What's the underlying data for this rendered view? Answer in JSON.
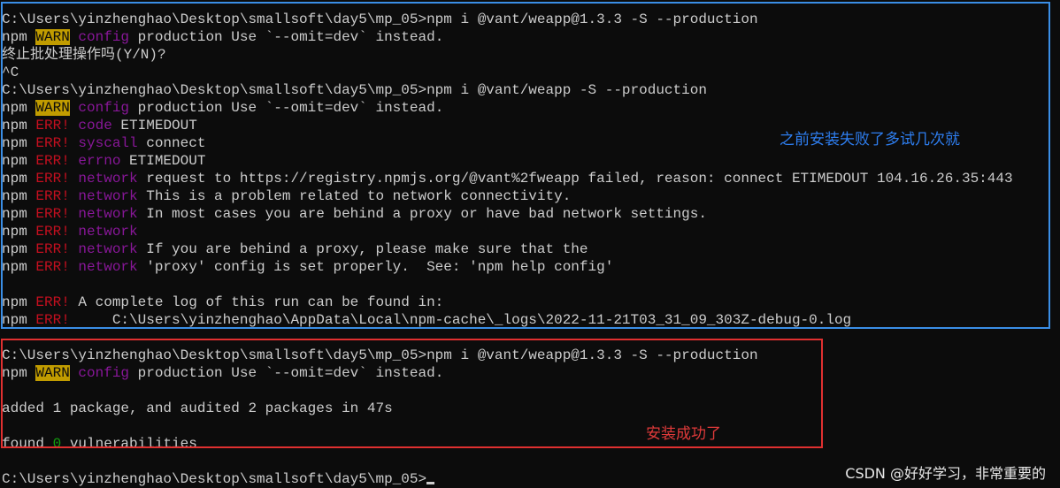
{
  "terminal": {
    "lines": [
      {
        "text": "C:\\Users\\yinzhenghao\\Desktop\\smallsoft\\day5\\mp_05>npm i @vant/weapp@1.3.3 -S --production"
      },
      {
        "prefix": "npm ",
        "tag": "WARN",
        "tagStyle": "warn",
        "key": " config",
        "keyStyle": "purple",
        "rest": " production Use `--omit=dev` instead."
      },
      {
        "text": "终止批处理操作吗(Y/N)?"
      },
      {
        "text": "^C"
      },
      {
        "text": "C:\\Users\\yinzhenghao\\Desktop\\smallsoft\\day5\\mp_05>npm i @vant/weapp -S --production"
      },
      {
        "prefix": "npm ",
        "tag": "WARN",
        "tagStyle": "warn",
        "key": " config",
        "keyStyle": "purple",
        "rest": " production Use `--omit=dev` instead."
      },
      {
        "prefix": "npm ",
        "tag": "ERR!",
        "tagStyle": "red",
        "key": " code",
        "keyStyle": "purple",
        "rest": " ETIMEDOUT"
      },
      {
        "prefix": "npm ",
        "tag": "ERR!",
        "tagStyle": "red",
        "key": " syscall",
        "keyStyle": "purple",
        "rest": " connect"
      },
      {
        "prefix": "npm ",
        "tag": "ERR!",
        "tagStyle": "red",
        "key": " errno",
        "keyStyle": "purple",
        "rest": " ETIMEDOUT"
      },
      {
        "prefix": "npm ",
        "tag": "ERR!",
        "tagStyle": "red",
        "key": " network",
        "keyStyle": "purple",
        "rest": " request to https://registry.npmjs.org/@vant%2fweapp failed, reason: connect ETIMEDOUT 104.16.26.35:443"
      },
      {
        "prefix": "npm ",
        "tag": "ERR!",
        "tagStyle": "red",
        "key": " network",
        "keyStyle": "purple",
        "rest": " This is a problem related to network connectivity."
      },
      {
        "prefix": "npm ",
        "tag": "ERR!",
        "tagStyle": "red",
        "key": " network",
        "keyStyle": "purple",
        "rest": " In most cases you are behind a proxy or have bad network settings."
      },
      {
        "prefix": "npm ",
        "tag": "ERR!",
        "tagStyle": "red",
        "key": " network",
        "keyStyle": "purple",
        "rest": ""
      },
      {
        "prefix": "npm ",
        "tag": "ERR!",
        "tagStyle": "red",
        "key": " network",
        "keyStyle": "purple",
        "rest": " If you are behind a proxy, please make sure that the"
      },
      {
        "prefix": "npm ",
        "tag": "ERR!",
        "tagStyle": "red",
        "key": " network",
        "keyStyle": "purple",
        "rest": " 'proxy' config is set properly.  See: 'npm help config'"
      },
      {
        "text": ""
      },
      {
        "prefix": "npm ",
        "tag": "ERR!",
        "tagStyle": "red",
        "rest": " A complete log of this run can be found in:"
      },
      {
        "prefix": "npm ",
        "tag": "ERR!",
        "tagStyle": "red",
        "rest": "     C:\\Users\\yinzhenghao\\AppData\\Local\\npm-cache\\_logs\\2022-11-21T03_31_09_303Z-debug-0.log"
      },
      {
        "text": ""
      },
      {
        "text": "C:\\Users\\yinzhenghao\\Desktop\\smallsoft\\day5\\mp_05>npm i @vant/weapp@1.3.3 -S --production"
      },
      {
        "prefix": "npm ",
        "tag": "WARN",
        "tagStyle": "warn",
        "key": " config",
        "keyStyle": "purple",
        "rest": " production Use `--omit=dev` instead."
      },
      {
        "text": ""
      },
      {
        "text": "added 1 package, and audited 2 packages in 47s"
      },
      {
        "text": ""
      },
      {
        "prefix": "found ",
        "tag": "0",
        "tagStyle": "green",
        "rest": " vulnerabilities"
      },
      {
        "text": ""
      },
      {
        "text": "C:\\Users\\yinzhenghao\\Desktop\\smallsoft\\day5\\mp_05>",
        "cursor": true
      }
    ]
  },
  "annotations": {
    "blue_note": "之前安装失败了多试几次就",
    "red_note": "安装成功了",
    "blue_color": "#3a8ee6",
    "red_color": "#e03030"
  },
  "watermark": "CSDN @好好学习，非常重要的",
  "colors": {
    "background": "#0c0c0c",
    "foreground": "#cccccc",
    "warn_bg": "#c19c00",
    "purple": "#881798",
    "red": "#c50f1f",
    "green": "#13a10e"
  }
}
